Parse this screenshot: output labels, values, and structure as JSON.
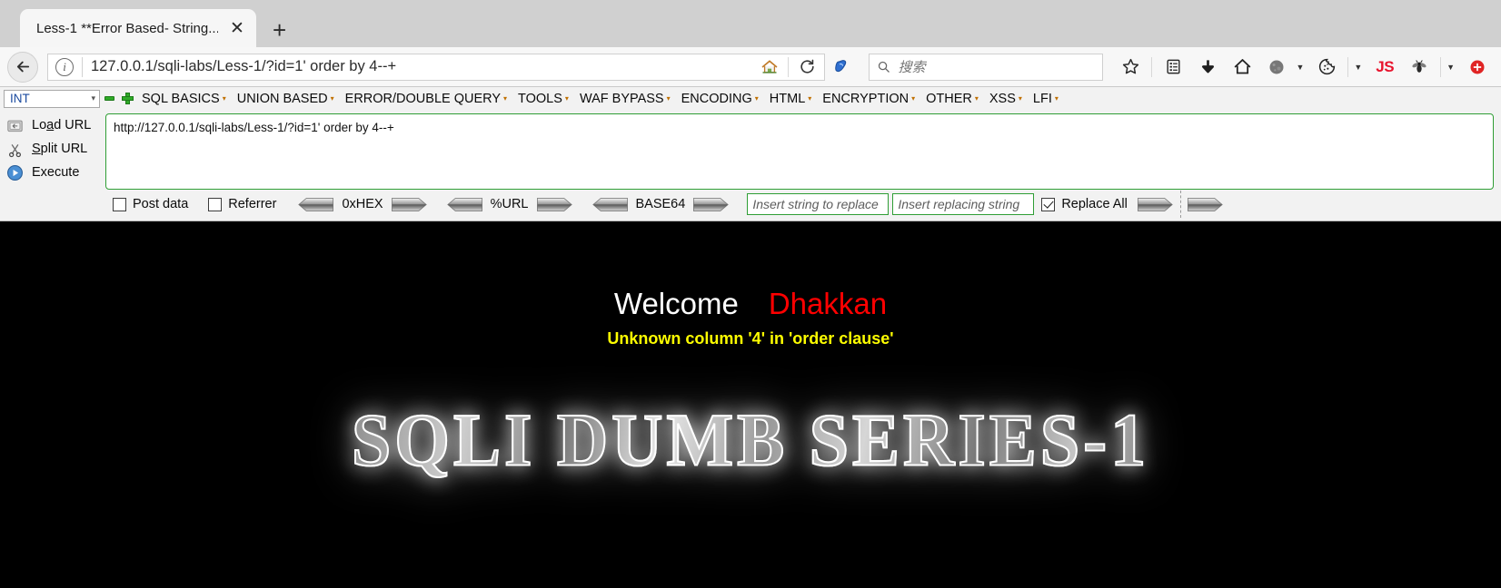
{
  "browser": {
    "tab": {
      "title": "Less-1 **Error Based- String...",
      "close_icon": "close-icon",
      "new_tab_icon": "+"
    },
    "nav": {
      "back_icon": "←",
      "info_icon": "i",
      "url": "127.0.0.1/sqli-labs/Less-1/?id=1' order by 4--+",
      "home_icon": "home-icon",
      "reload_icon": "⟳",
      "shield_icon": "shield-icon"
    },
    "search": {
      "icon": "search-icon",
      "placeholder": "搜索"
    },
    "toolbar_icons": [
      {
        "name": "bookmark-star-icon",
        "glyph": "☆"
      },
      {
        "name": "library-icon",
        "glyph": "Ὄb"
      },
      {
        "name": "download-icon",
        "glyph": "⬇"
      },
      {
        "name": "home-icon",
        "glyph": "⌂"
      },
      {
        "name": "globe-icon",
        "glyph": "●"
      },
      {
        "name": "cookie-icon",
        "glyph": "◔"
      },
      {
        "name": "js-badge",
        "glyph": "JS"
      },
      {
        "name": "fly-bug-icon",
        "glyph": "✵"
      }
    ],
    "js_label": "JS"
  },
  "hackbar": {
    "type_select": {
      "value": "INT",
      "caret": "∨"
    },
    "minus_label": "−",
    "plus_label": "+",
    "menu": [
      {
        "label": "SQL BASICS",
        "caret": "▾"
      },
      {
        "label": "UNION BASED",
        "caret": "▾"
      },
      {
        "label": "ERROR/DOUBLE QUERY",
        "caret": "▾"
      },
      {
        "label": "TOOLS",
        "caret": "▾"
      },
      {
        "label": "WAF BYPASS",
        "caret": "▾"
      },
      {
        "label": "ENCODING",
        "caret": "▾"
      },
      {
        "label": "HTML",
        "caret": "▾"
      },
      {
        "label": "ENCRYPTION",
        "caret": "▾"
      },
      {
        "label": "OTHER",
        "caret": "▾"
      },
      {
        "label": "XSS",
        "caret": "▾"
      },
      {
        "label": "LFI",
        "caret": "▾"
      }
    ],
    "actions": [
      {
        "name": "load-url",
        "label_pre": "Lo",
        "label_accel": "a",
        "label_post": "d URL",
        "icon": "load-url-icon"
      },
      {
        "name": "split-url",
        "label_pre": "",
        "label_accel": "S",
        "label_post": "plit URL",
        "icon": "scissors-icon"
      },
      {
        "name": "execute",
        "label_pre": "",
        "label_accel": "",
        "label_post": "Execute",
        "icon": "execute-play-icon"
      }
    ],
    "request_textarea": "http://127.0.0.1/sqli-labs/Less-1/?id=1' order by 4--+",
    "options": {
      "post_data": {
        "label": "Post data",
        "checked": false
      },
      "referrer": {
        "label": "Referrer",
        "checked": false
      },
      "encoders": [
        {
          "label": "0xHEX"
        },
        {
          "label": "%URL"
        },
        {
          "label": "BASE64"
        }
      ],
      "replace_from_placeholder": "Insert string to replace",
      "replace_from_value": "",
      "replace_to_placeholder": "Insert replacing string",
      "replace_to_value": "",
      "replace_all": {
        "label": "Replace All",
        "checked": true
      }
    }
  },
  "page": {
    "welcome": "Welcome",
    "name": "Dhakkan",
    "error": "Unknown column '4' in 'order clause'",
    "banner": "SQLI DUMB SERIES-1",
    "colors": {
      "welcome": "#ffffff",
      "name": "#ff0000",
      "error": "#ffff00",
      "background": "#000000"
    }
  }
}
